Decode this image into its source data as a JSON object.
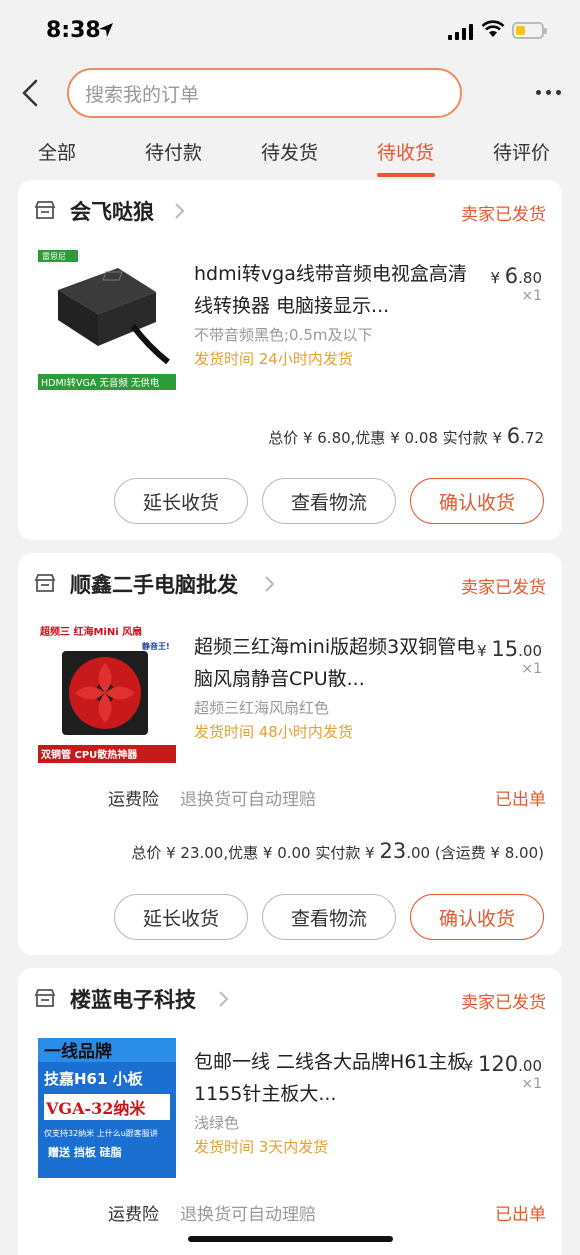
{
  "status": {
    "time": "8:38"
  },
  "search": {
    "placeholder": "搜索我的订单"
  },
  "tabs": [
    {
      "label": "全部"
    },
    {
      "label": "待付款"
    },
    {
      "label": "待发货"
    },
    {
      "label": "待收货",
      "active": true
    },
    {
      "label": "待评价"
    }
  ],
  "orders": [
    {
      "shop": "会飞哒狼",
      "status": "卖家已发货",
      "item": {
        "title": "hdmi转vga线带音频电视盒高清线转换器 电脑接显示...",
        "spec": "不带音频黑色;0.5m及以下",
        "ship_time": "发货时间 24小时内发货",
        "price_symbol": "¥",
        "price_int": "6",
        "price_dec": ".80",
        "qty": "×1",
        "thumb_brand": "雷思尼",
        "thumb_caption": "HDMI转VGA 无音频 无供电"
      },
      "totals": {
        "prefix": "总价 ¥ 6.80,优惠 ¥ 0.08 实付款 ¥ ",
        "big": "6",
        "tail": ".72",
        "suffix": ""
      },
      "buttons": [
        "延长收货",
        "查看物流",
        "确认收货"
      ]
    },
    {
      "shop": "顺鑫二手电脑批发",
      "status": "卖家已发货",
      "item": {
        "title": "超频三红海mini版超频3双铜管电脑风扇静音CPU散...",
        "spec": "超频三红海风扇红色",
        "ship_time": "发货时间 48小时内发货",
        "price_symbol": "¥",
        "price_int": "15",
        "price_dec": ".00",
        "qty": "×1",
        "thumb_top": "超频三 红海MiNi 风扇",
        "thumb_sub": "静音王!",
        "thumb_caption": "双铜管  CPU散热神器"
      },
      "insurance": {
        "label": "运费险",
        "desc": "退换货可自动理赔",
        "status": "已出单"
      },
      "totals": {
        "prefix": "总价 ¥ 23.00,优惠 ¥ 0.00 实付款 ¥ ",
        "big": "23",
        "tail": ".00",
        "suffix": " (含运费 ¥ 8.00)"
      },
      "buttons": [
        "延长收货",
        "查看物流",
        "确认收货"
      ]
    },
    {
      "shop": "楼蓝电子科技",
      "status": "卖家已发货",
      "item": {
        "title": "包邮一线 二线各大品牌H61主板 1155针主板大...",
        "spec": "浅绿色",
        "ship_time": "发货时间 3天内发货",
        "price_symbol": "¥",
        "price_int": "120",
        "price_dec": ".00",
        "qty": "×1",
        "thumb_l1": "一线品牌",
        "thumb_l2": "技嘉H61 小板",
        "thumb_l3": "VGA-32纳米",
        "thumb_l4": "仅支持32纳米 上什么u跟客服讲",
        "thumb_l5": "赠送 挡板 硅脂"
      },
      "insurance": {
        "label": "运费险",
        "desc": "退换货可自动理赔",
        "status": "已出单"
      }
    }
  ],
  "colors": {
    "accent": "#e8572b",
    "ship": "#e8a030",
    "bg": "#f2f2f2"
  }
}
